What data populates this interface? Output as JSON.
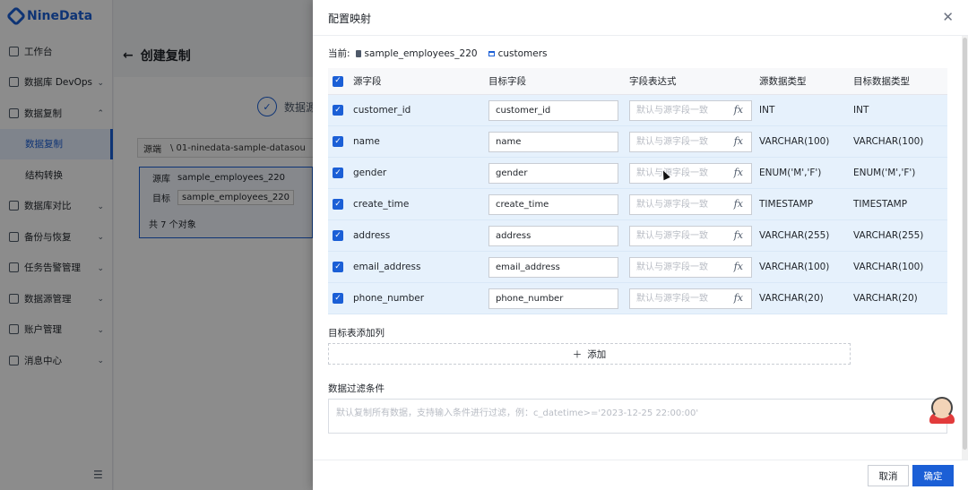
{
  "app": {
    "brand": "NineData",
    "sidebar": [
      {
        "label": "工作台",
        "icon": "home-icon",
        "chevron": ""
      },
      {
        "label": "数据库 DevOps",
        "icon": "database-icon",
        "chevron": "⌄"
      },
      {
        "label": "数据复制",
        "icon": "copy-icon",
        "chevron": "⌃"
      },
      {
        "label": "数据复制",
        "icon": "",
        "chevron": "",
        "sub": true,
        "active": true
      },
      {
        "label": "结构转换",
        "icon": "",
        "chevron": "",
        "sub": true
      },
      {
        "label": "数据库对比",
        "icon": "compare-icon",
        "chevron": "⌄"
      },
      {
        "label": "备份与恢复",
        "icon": "backup-icon",
        "chevron": "⌄"
      },
      {
        "label": "任务告警管理",
        "icon": "alert-icon",
        "chevron": "⌄"
      },
      {
        "label": "数据源管理",
        "icon": "datasource-icon",
        "chevron": "⌄"
      },
      {
        "label": "账户管理",
        "icon": "account-icon",
        "chevron": "⌄"
      },
      {
        "label": "消息中心",
        "icon": "message-icon",
        "chevron": "⌄"
      }
    ],
    "page_title": "创建复制",
    "step_label": "数据源",
    "source_label": "源端",
    "source_value": "\\ 01-ninedata-sample-datasou",
    "obj_source_label": "源库",
    "obj_source_value": "sample_employees_220",
    "obj_target_label": "目标",
    "obj_target_value": "sample_employees_220",
    "obj_count": "共 7 个对象"
  },
  "drawer": {
    "title": "配置映射",
    "current_label": "当前:",
    "current_db": "sample_employees_220",
    "current_table": "customers",
    "columns": {
      "source": "源字段",
      "target": "目标字段",
      "expression": "字段表达式",
      "source_type": "源数据类型",
      "target_type": "目标数据类型"
    },
    "expr_placeholder": "默认与源字段一致",
    "fx_label": "fx",
    "rows": [
      {
        "source": "customer_id",
        "target": "customer_id",
        "source_type": "INT",
        "target_type": "INT"
      },
      {
        "source": "name",
        "target": "name",
        "source_type": "VARCHAR(100)",
        "target_type": "VARCHAR(100)"
      },
      {
        "source": "gender",
        "target": "gender",
        "source_type": "ENUM('M','F')",
        "target_type": "ENUM('M','F')"
      },
      {
        "source": "create_time",
        "target": "create_time",
        "source_type": "TIMESTAMP",
        "target_type": "TIMESTAMP"
      },
      {
        "source": "address",
        "target": "address",
        "source_type": "VARCHAR(255)",
        "target_type": "VARCHAR(255)"
      },
      {
        "source": "email_address",
        "target": "email_address",
        "source_type": "VARCHAR(100)",
        "target_type": "VARCHAR(100)"
      },
      {
        "source": "phone_number",
        "target": "phone_number",
        "source_type": "VARCHAR(20)",
        "target_type": "VARCHAR(20)"
      }
    ],
    "add_column_label": "目标表添加列",
    "add_button": "添加",
    "filter_label": "数据过滤条件",
    "filter_placeholder": "默认复制所有数据，支持输入条件进行过滤，例：c_datetime>='2023-12-25 22:00:00'",
    "cancel": "取消",
    "confirm": "确定"
  },
  "colors": {
    "accent": "#1b5fd6",
    "row_highlight": "#e6f1fc"
  }
}
